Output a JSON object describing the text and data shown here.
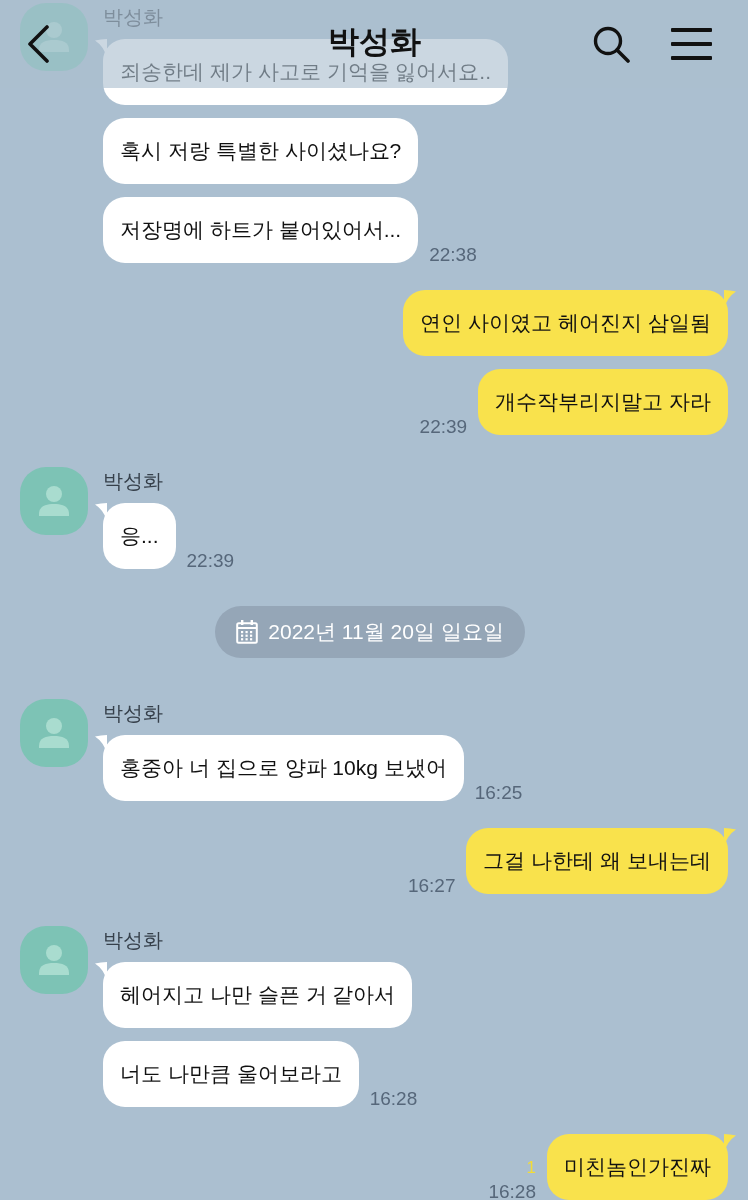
{
  "header": {
    "title": "박성화"
  },
  "timeline": [
    {
      "kind": "incoming",
      "sender": "박성화",
      "bubbles": [
        "죄송한데 제가 사고로 기억을 잃어서요..",
        "혹시 저랑 특별한 사이셨나요?",
        "저장명에 하트가 붙어있어서..."
      ],
      "time": "22:38"
    },
    {
      "kind": "outgoing",
      "bubbles": [
        "연인 사이였고 헤어진지 삼일됨",
        "개수작부리지말고 자라"
      ],
      "time": "22:39"
    },
    {
      "kind": "incoming",
      "sender": "박성화",
      "bubbles": [
        "응..."
      ],
      "time": "22:39"
    },
    {
      "kind": "date",
      "text": "2022년 11월 20일 일요일"
    },
    {
      "kind": "incoming",
      "sender": "박성화",
      "bubbles": [
        "홍중아 너 집으로 양파 10kg 보냈어"
      ],
      "time": "16:25"
    },
    {
      "kind": "outgoing",
      "bubbles": [
        "그걸 나한테 왜 보내는데"
      ],
      "time": "16:27"
    },
    {
      "kind": "incoming",
      "sender": "박성화",
      "bubbles": [
        "헤어지고 나만 슬픈 거 같아서",
        "너도 나만큼 울어보라고"
      ],
      "time": "16:28"
    },
    {
      "kind": "outgoing",
      "bubbles": [
        "미친놈인가진짜"
      ],
      "unread": "1",
      "time": "16:28"
    }
  ]
}
